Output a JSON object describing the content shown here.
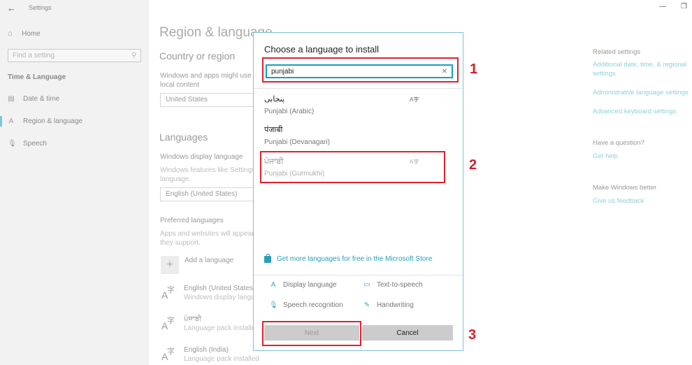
{
  "window": {
    "title": "Settings",
    "back_icon": "back-arrow-icon",
    "minimize_glyph": "—",
    "restore_glyph": "❐"
  },
  "sidebar": {
    "home_label": "Home",
    "search_placeholder": "Find a setting",
    "section_title": "Time & Language",
    "items": [
      {
        "label": "Date & time",
        "icon": "calendar-clock-icon"
      },
      {
        "label": "Region & language",
        "icon": "language-icon",
        "active": true
      },
      {
        "label": "Speech",
        "icon": "microphone-icon"
      }
    ]
  },
  "main": {
    "page_title": "Region & language",
    "country": {
      "heading": "Country or region",
      "desc_line1": "Windows and apps might use",
      "desc_line2": "local content",
      "value": "United States"
    },
    "languages": {
      "heading": "Languages",
      "display_label": "Windows display language",
      "display_desc_line1": "Windows features like Settings",
      "display_desc_line2": "language.",
      "display_value": "English (United States)",
      "preferred_label": "Preferred languages",
      "preferred_desc_line1": "Apps and websites will appear",
      "preferred_desc_line2": "they support.",
      "add_label": "Add a language",
      "list": [
        {
          "name": "English (United States)",
          "status": "Windows display langu"
        },
        {
          "name": "ਪੰਜਾਬੀ",
          "status": "Language pack installed"
        },
        {
          "name": "English (India)",
          "status": "Language pack installed"
        }
      ]
    }
  },
  "related": {
    "heading": "Related settings",
    "links": [
      "Additional date, time, & regional",
      "settings",
      "Administrative language settings",
      "Advanced keyboard settings"
    ],
    "question_heading": "Have a question?",
    "help_link": "Get help",
    "better_heading": "Make Windows better",
    "feedback_link": "Give us feedback"
  },
  "dialog": {
    "title": "Choose a language to install",
    "search_value": "punjabi",
    "clear_glyph": "✕",
    "options": [
      {
        "native": "پنجابی",
        "english": "Punjabi (Arabic)",
        "has_display_icon": true
      },
      {
        "native": "पंजाबी",
        "english": "Punjabi (Devanagari)",
        "has_display_icon": false
      },
      {
        "native": "ਪੰਜਾਬੀ",
        "english": "Punjabi (Gurmukhi)",
        "has_display_icon": true,
        "dimmed": true
      }
    ],
    "store_link": "Get more languages for free in the Microsoft Store",
    "features": [
      {
        "label": "Display language",
        "icon": "display-language-icon"
      },
      {
        "label": "Text-to-speech",
        "icon": "text-to-speech-icon"
      },
      {
        "label": "Speech recognition",
        "icon": "speech-recognition-icon"
      },
      {
        "label": "Handwriting",
        "icon": "handwriting-icon"
      }
    ],
    "next_label": "Next",
    "cancel_label": "Cancel"
  },
  "annotations": {
    "step1": "1",
    "step2": "2",
    "step3": "3",
    "color": "#e0202e"
  }
}
